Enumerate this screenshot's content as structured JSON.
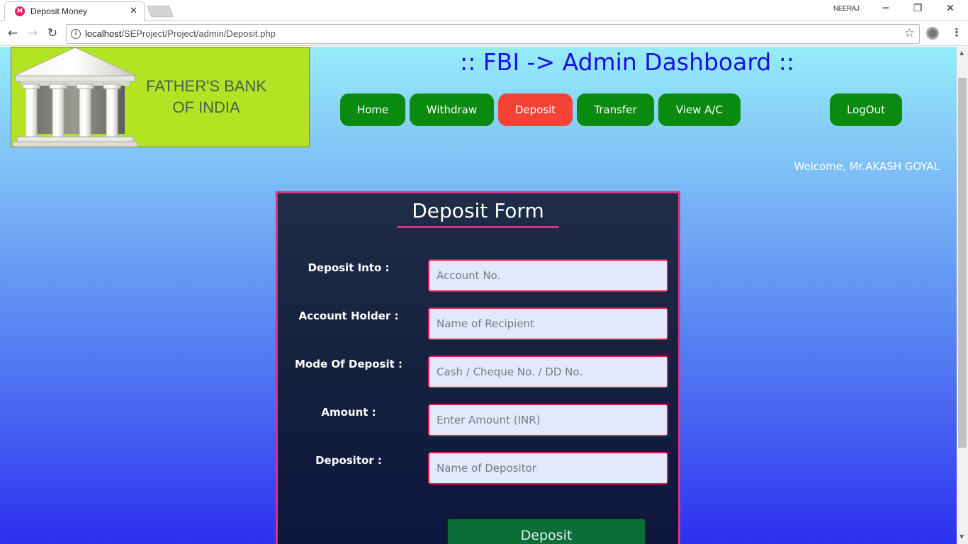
{
  "browser": {
    "tab_title": "Deposit Money",
    "tab_favicon": "M",
    "profile_name": "NEERAJ",
    "url_host": "localhost",
    "url_path": "/SEProject/Project/admin/Deposit.php"
  },
  "header": {
    "logo_line1": "FATHER'S BANK",
    "logo_line2": "OF INDIA",
    "dashboard_title": ":: FBI -> Admin Dashboard ::"
  },
  "nav": {
    "home": "Home",
    "withdraw": "Withdraw",
    "deposit": "Deposit",
    "transfer": "Transfer",
    "view_ac": "View A/C",
    "logout": "LogOut"
  },
  "welcome_text": "Welcome, Mr.AKASH GOYAL",
  "form": {
    "title": "Deposit Form",
    "fields": [
      {
        "label": "Deposit Into :",
        "placeholder": "Account No.",
        "value": ""
      },
      {
        "label": "Account Holder :",
        "placeholder": "Name of Recipient",
        "value": ""
      },
      {
        "label": "Mode Of Deposit :",
        "placeholder": "Cash / Cheque No. / DD No.",
        "value": ""
      },
      {
        "label": "Amount :",
        "placeholder": "Enter Amount (INR)",
        "value": ""
      },
      {
        "label": "Depositor :",
        "placeholder": "Name of Depositor",
        "value": ""
      }
    ],
    "submit_label": "Deposit"
  },
  "colors": {
    "nav_button": "#0a8a0e",
    "nav_active": "#f44336",
    "form_border": "#d63384",
    "input_border": "#e0204e",
    "title_color": "#1a10e0"
  }
}
